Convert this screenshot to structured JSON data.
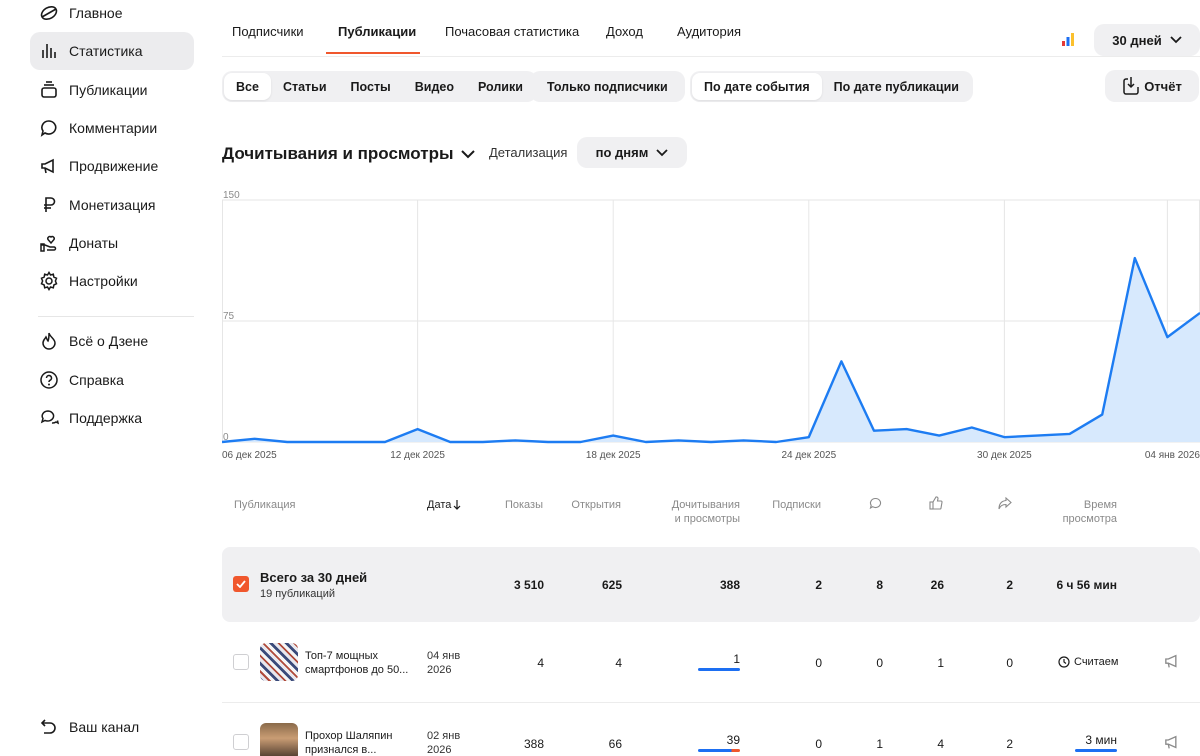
{
  "sidebar": {
    "items": [
      {
        "label": "Главное",
        "icon": "zen-logo-icon"
      },
      {
        "label": "Статистика",
        "icon": "stats-bars-icon"
      },
      {
        "label": "Публикации",
        "icon": "publications-stack-icon"
      },
      {
        "label": "Комментарии",
        "icon": "comment-bubble-icon"
      },
      {
        "label": "Продвижение",
        "icon": "megaphone-icon"
      },
      {
        "label": "Монетизация",
        "icon": "ruble-icon"
      },
      {
        "label": "Донаты",
        "icon": "donate-hand-icon"
      },
      {
        "label": "Настройки",
        "icon": "gear-icon"
      },
      {
        "label": "Всё о Дзене",
        "icon": "flame-icon"
      },
      {
        "label": "Справка",
        "icon": "help-circle-icon"
      },
      {
        "label": "Поддержка",
        "icon": "support-chat-icon"
      }
    ],
    "channel_label": "Ваш канал"
  },
  "tabs": {
    "items": [
      "Подписчики",
      "Публикации",
      "Почасовая статистика",
      "Доход",
      "Аудитория"
    ],
    "active": "Публикации",
    "period": "30 дней"
  },
  "filters": {
    "types": [
      "Все",
      "Статьи",
      "Посты",
      "Видео",
      "Ролики"
    ],
    "selected_type": "Все",
    "subscribers_only": "Только подписчики",
    "date_modes": [
      "По дате события",
      "По дате публикации"
    ],
    "selected_date_mode": "По дате события",
    "report": "Отчёт"
  },
  "chart_header": {
    "metric": "Дочитывания и просмотры",
    "detail_label": "Детализация",
    "detail_value": "по дням"
  },
  "chart_data": {
    "type": "area",
    "ylim": [
      0,
      150
    ],
    "y_ticks": [
      "0",
      "75",
      "150"
    ],
    "x_tick_labels": [
      "06 дек 2025",
      "12 дек 2025",
      "18 дек 2025",
      "24 дек 2025",
      "30 дек 2025",
      "04 янв 2026"
    ],
    "x": [
      "06 дек 2025",
      "07 дек 2025",
      "08 дек 2025",
      "09 дек 2025",
      "10 дек 2025",
      "11 дек 2025",
      "12 дек 2025",
      "13 дек 2025",
      "14 дек 2025",
      "15 дек 2025",
      "16 дек 2025",
      "17 дек 2025",
      "18 дек 2025",
      "19 дек 2025",
      "20 дек 2025",
      "21 дек 2025",
      "22 дек 2025",
      "23 дек 2025",
      "24 дек 2025",
      "25 дек 2025",
      "26 дек 2025",
      "27 дек 2025",
      "28 дек 2025",
      "29 дек 2025",
      "30 дек 2025",
      "31 дек 2025",
      "01 янв 2026",
      "02 янв 2026",
      "03 янв 2026",
      "04 янв 2026",
      "05 янв 2026"
    ],
    "series": [
      {
        "values": [
          0,
          2,
          0,
          0,
          0,
          0,
          8,
          0,
          0,
          1,
          0,
          0,
          4,
          0,
          1,
          0,
          1,
          0,
          3,
          50,
          7,
          8,
          4,
          9,
          3,
          4,
          5,
          17,
          114,
          65,
          80
        ]
      }
    ],
    "grid": true,
    "color": "#1d7cf2",
    "fill": "#d7e9fd"
  },
  "table": {
    "headers": {
      "publication": "Публикация",
      "date": "Дата",
      "impressions": "Показы",
      "opens": "Открытия",
      "reads_line1": "Дочитывания",
      "reads_line2": "и просмотры",
      "subscriptions": "Подписки",
      "time_line1": "Время",
      "time_line2": "просмотра"
    },
    "total": {
      "title": "Всего за 30 дней",
      "subtitle": "19 публикаций",
      "impressions": "3 510",
      "opens": "625",
      "reads": "388",
      "subscriptions": "2",
      "comments": "8",
      "likes": "26",
      "shares": "2",
      "time": "6 ч 56 мин"
    },
    "rows": [
      {
        "title_line1": "Топ-7 мощных",
        "title_line2": "смартфонов до 50...",
        "date_line1": "04 янв",
        "date_line2": "2026",
        "impressions": "4",
        "opens": "4",
        "reads": "1",
        "subscriptions": "0",
        "comments": "0",
        "likes": "1",
        "shares": "0",
        "time": "Считаем"
      },
      {
        "title_line1": "Прохор Шаляпин",
        "title_line2": "признался в...",
        "date_line1": "02 янв",
        "date_line2": "2026",
        "impressions": "388",
        "opens": "66",
        "reads": "39",
        "subscriptions": "0",
        "comments": "1",
        "likes": "4",
        "shares": "2",
        "time": "3 мин"
      }
    ]
  },
  "colors": {
    "accent": "#f0572d",
    "blue": "#1d6ff2",
    "panel": "#f0f0f2"
  }
}
